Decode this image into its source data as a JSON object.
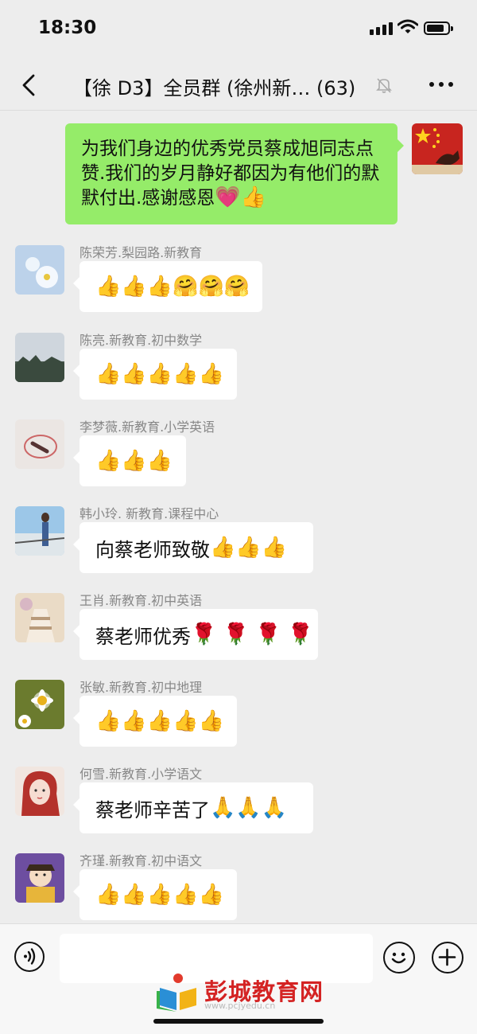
{
  "status_bar": {
    "time": "18:30"
  },
  "nav": {
    "title": "【徐 D3】全员群 (徐州新…  (63)"
  },
  "my_message": {
    "text": "为我们身边的优秀党员蔡成旭同志点赞.我们的岁月静好都因为有他们的默默付出.感谢感恩",
    "emoji": "💗👍"
  },
  "messages": [
    {
      "sender": "陈荣芳.梨园路.新教育",
      "text": "",
      "emoji": "👍👍👍🤗🤗🤗"
    },
    {
      "sender": "陈亮.新教育.初中数学",
      "text": "",
      "emoji": "👍👍👍👍👍"
    },
    {
      "sender": "李梦薇.新教育.小学英语",
      "text": "",
      "emoji": "👍👍👍"
    },
    {
      "sender": "韩小玲. 新教育.课程中心",
      "text": "向蔡老师致敬",
      "emoji": "👍👍👍"
    },
    {
      "sender": "王肖.新教育.初中英语",
      "text": "蔡老师优秀",
      "emoji": " 🌹 🌹 🌹 🌹"
    },
    {
      "sender": "张敏.新教育.初中地理",
      "text": "",
      "emoji": "👍👍👍👍👍"
    },
    {
      "sender": "何雪.新教育.小学语文",
      "text": "蔡老师辛苦了",
      "emoji": "🙏🙏🙏"
    },
    {
      "sender": "齐瑾.新教育.初中语文",
      "text": "",
      "emoji": "👍👍👍👍👍"
    }
  ],
  "watermark": {
    "name": "彭城教育网",
    "url": "www.pcjyedu.cn"
  },
  "icons": {
    "back": "chevron-left-icon",
    "mute": "bell-off-icon",
    "more": "more-dots-icon",
    "voice": "voice-icon",
    "emoji": "emoji-face-icon",
    "plus": "plus-icon"
  },
  "colors": {
    "my_bubble": "#95ec69",
    "background": "#ededed",
    "watermark": "#d42323"
  }
}
